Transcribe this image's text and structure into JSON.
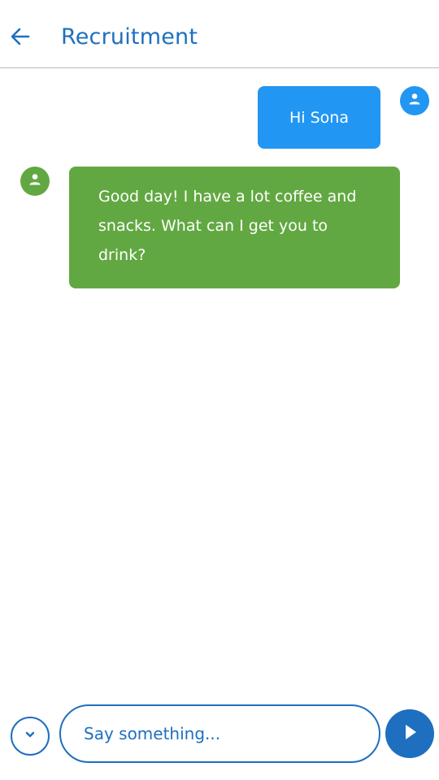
{
  "header": {
    "title": "Recruitment",
    "back_icon": "arrow-left-icon"
  },
  "colors": {
    "accent": "#1e6fc0",
    "user_bubble": "#2196f3",
    "bot_bubble": "#62a842",
    "divider": "#b9b9b9"
  },
  "messages": [
    {
      "sender": "user",
      "text": "Hi Sona",
      "avatar_icon": "person-icon"
    },
    {
      "sender": "bot",
      "text": "Good day! I have a lot coffee and snacks. What can I get you to drink?",
      "avatar_icon": "person-icon"
    }
  ],
  "composer": {
    "placeholder": "Say something...",
    "value": "",
    "scroll_icon": "chevron-down-icon",
    "send_icon": "play-icon"
  }
}
